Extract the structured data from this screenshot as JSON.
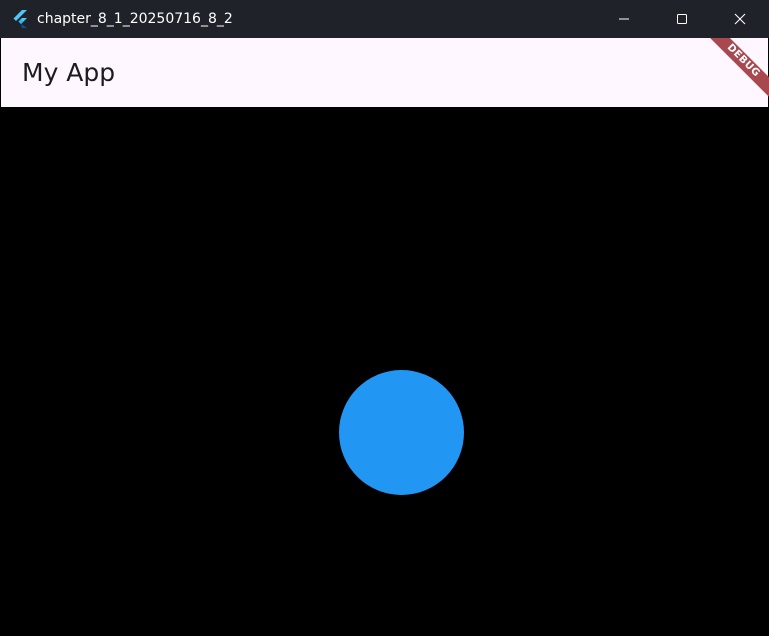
{
  "window": {
    "title": "chapter_8_1_20250716_8_2",
    "icon": "flutter-icon",
    "controls": {
      "minimize_icon": "minimize-icon",
      "maximize_icon": "maximize-icon",
      "close_icon": "close-icon"
    }
  },
  "appbar": {
    "title": "My App"
  },
  "debug_banner": {
    "label": "DEBUG",
    "color": "#a8494f"
  },
  "content": {
    "circle_color": "#2196f3",
    "background_color": "#000000"
  },
  "colors": {
    "titlebar": "#1f2329",
    "appbar": "#fef7ff"
  }
}
